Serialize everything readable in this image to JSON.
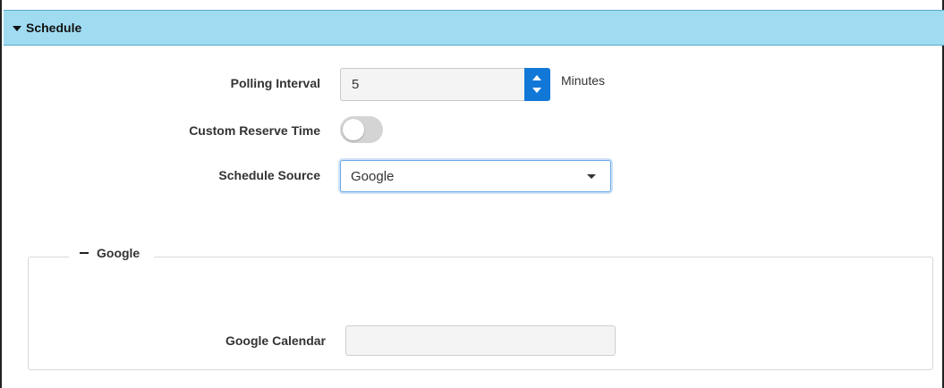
{
  "section": {
    "title": "Schedule"
  },
  "polling_interval": {
    "label": "Polling Interval",
    "value": "5",
    "units": "Minutes"
  },
  "custom_reserve_time": {
    "label": "Custom Reserve Time",
    "enabled": false
  },
  "schedule_source": {
    "label": "Schedule Source",
    "selected": "Google"
  },
  "google_group": {
    "title": "Google",
    "calendar": {
      "label": "Google Calendar",
      "value": ""
    }
  },
  "colors": {
    "header_bg": "#9fdcf1",
    "spinner_accent": "#1278d8",
    "toggle_off": "#d4d4d4"
  }
}
